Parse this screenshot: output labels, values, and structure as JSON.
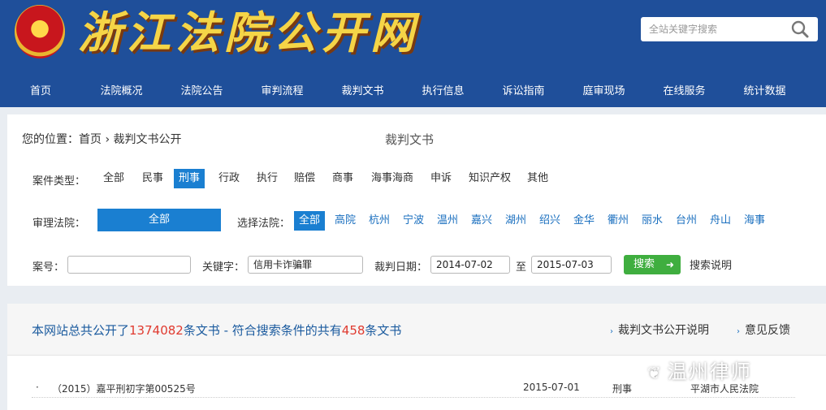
{
  "header": {
    "site_title": "浙江法院公开网",
    "search_placeholder": "全站关键字搜索"
  },
  "nav": [
    "首页",
    "法院概况",
    "法院公告",
    "审判流程",
    "裁判文书",
    "执行信息",
    "诉讼指南",
    "庭审现场",
    "在线服务",
    "统计数据"
  ],
  "panel": {
    "breadcrumb_prefix": "您的位置：",
    "breadcrumb_home": "首页",
    "breadcrumb_sep": "›",
    "breadcrumb_current": "裁判文书公开",
    "title": "裁判文书"
  },
  "case_type": {
    "label": "案件类型：",
    "options": [
      "全部",
      "民事",
      "刑事",
      "行政",
      "执行",
      "赔偿",
      "商事",
      "海事海商",
      "申诉",
      "知识产权",
      "其他"
    ],
    "selected": "刑事"
  },
  "court": {
    "label": "审理法院：",
    "all_label": "全部",
    "select_label": "选择法院：",
    "options": [
      "全部",
      "高院",
      "杭州",
      "宁波",
      "温州",
      "嘉兴",
      "湖州",
      "绍兴",
      "金华",
      "衢州",
      "丽水",
      "台州",
      "舟山",
      "海事"
    ],
    "selected": "全部"
  },
  "search_form": {
    "case_no_label": "案号：",
    "case_no_value": "",
    "keyword_label": "关键字：",
    "keyword_value": "信用卡诈骗罪",
    "date_label": "裁判日期：",
    "date_from": "2014-07-02",
    "date_to_label": "至",
    "date_to": "2015-07-03",
    "search_button": "搜索",
    "help_link": "搜索说明"
  },
  "summary": {
    "prefix": "本网站总共公开了",
    "total": "1374082",
    "middle": "条文书 - 符合搜索条件的共有",
    "matched": "458",
    "suffix": "条文书",
    "link_explain": "裁判文书公开说明",
    "link_feedback": "意见反馈"
  },
  "results": [
    {
      "bullet": "·",
      "case_no": "（2015）嘉平刑初字第00525号",
      "date": "2015-07-01",
      "type": "刑事",
      "court": "平湖市人民法院"
    }
  ],
  "watermark": "温州律师",
  "colors": {
    "header_bg": "#1f4f9a",
    "active_blue": "#1a7fd1",
    "highlight_red": "#e03a2f",
    "search_green": "#3fae3f",
    "title_gold": "#f5d547"
  }
}
